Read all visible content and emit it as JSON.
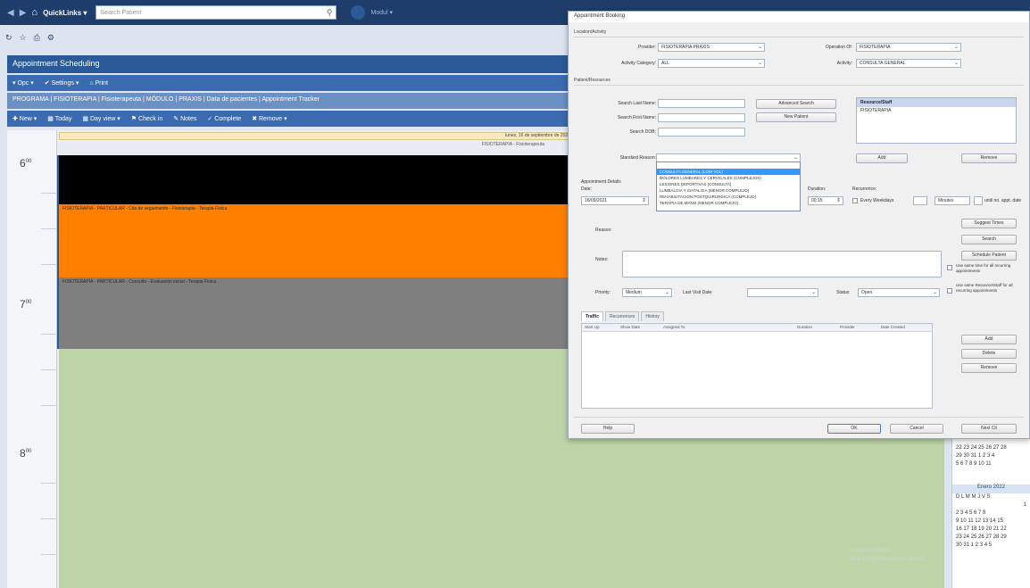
{
  "topbar": {
    "quicklinks_label": "QuickLinks ▾",
    "search_placeholder": "Search Patient",
    "menu_label": "Modul ▾"
  },
  "module": {
    "title": "Appointment Scheduling",
    "toolbar1": [
      "▾ Opc ▾",
      "✔ Settings ▾",
      "⌂ Print"
    ],
    "toolbar2": "PROGRAMA  | FISIOTERAPIA | Fisioterapeuta | MÓDULO | PRAXIS | Data de pacientes | Appointment Tracker",
    "toolbar3": [
      "✚ New ▾",
      "▦ Today",
      "▦ Day view ▾",
      "⚑ Check in",
      "✎ Notes",
      "✓ Complete",
      "✖ Remove ▾"
    ]
  },
  "calendar": {
    "day_header": "lunes, 16 de septiembre de 2021",
    "day_subheader": "FISIOTERAPIA - Fisioterapeuta",
    "hours": [
      "6",
      "7",
      "8"
    ],
    "appt_orange": "FISIOTERAPIA - PARTICULAR  -  Cita de seguimiento  -  Fisioterapia  -  Terapia Física",
    "appt_gray": "FISIOTERAPIA - PARTICULAR  -  Consulta  -  Evaluación inicial  -  Terapia Física"
  },
  "minical": {
    "month1_rows": [
      "22 23 24 25 26 27 28",
      "29 30 31 1 2 3 4",
      "5 6 7 8 9 10 11"
    ],
    "month2_head": "Enero 2022",
    "month2_rows": [
      "D L M M J V S",
      "1",
      "2 3 4 5 6 7 8",
      "9 10 11 12 13 14 15",
      "16 17 18 19 20 21 22",
      "23 24 25 26 27 28 29",
      "30 31 1 2 3 4 5"
    ]
  },
  "watermark": [
    "Activar Windows",
    "Ve a Configuración para activar"
  ],
  "dialog": {
    "title": "Appointment Booking",
    "sec_location": "Location/Activity",
    "lbl_provider": "Provider:",
    "val_provider": "FISIOTERAPIA PRAXIS",
    "lbl_operation": "Operation Of:",
    "val_operation": "FISIOTERAPIA",
    "lbl_activity_cat": "Activity Category:",
    "val_activity_cat": "ALL",
    "lbl_activity": "Activity:",
    "val_activity": "CONSULTA GENERAL",
    "sec_patient": "Patient/Resources",
    "lbl_last_name": "Search Last Name:",
    "lbl_first_name": "Search First Name:",
    "lbl_dob": "Search DOB:",
    "btn_advanced": "Advanced Search",
    "btn_new_patient": "New Patient",
    "res_head": "Resource/Staff",
    "res_row": "FISIOTERAPIA",
    "lbl_standard": "Standard Reason:",
    "btn_add": "Add",
    "btn_remove": "Remove",
    "dropdown_opts": [
      "CONSULTA GENERAL (LOW VOL)",
      "DOLORES LUMBARES Y CERVICALES (COMPLEJOS)",
      "LESIONES DEPORTIVAS (CONSULTA)",
      "LUMBALGIA Y SIATALGIA (MENOR COMPLEJO)",
      "REHABILITACION POSTQUIRURGICA (COMPLEJO)",
      "TERAPIA DE MANO (MENOR COMPLEJO)"
    ],
    "lbl_appt_details": "Appointment Details",
    "lbl_date": "Date:",
    "val_date": "16/09/2021",
    "lbl_duration": "Duration:",
    "val_duration": "00:15",
    "lbl_recurrence": "Recurrence:",
    "chk_every": "Every Weekdays",
    "lbl_minutes": "Minutes",
    "lbl_until": "until no. appt. date",
    "lbl_reason": "Reason:",
    "lbl_notes": "Notes:",
    "btn_suggest": "Suggest Times",
    "btn_search": "Search",
    "btn_schedule": "Schedule Patient",
    "chk_sms": "Use same time for all recurring appointments",
    "chk_send": "Use same Resource/Staff for all recurring appointments",
    "lbl_priority": "Priority:",
    "val_priority": "Medium",
    "lbl_last_visit": "Last Visit Date:",
    "lbl_status": "Status:",
    "val_status": "Open",
    "tab_traffic": "Traffic",
    "tab_recurrences": "Recurrences",
    "tab_history": "History",
    "grid_cols": [
      "Start Up",
      "Show Date",
      "Assigned To",
      "Duration",
      "Provider",
      "Date Created"
    ],
    "btn_add2": "Add",
    "btn_delete": "Delete",
    "btn_remove2": "Remove",
    "btn_help": "Help",
    "btn_ok": "OK",
    "btn_cancel": "Cancel",
    "btn_next": "Next Cit"
  },
  "colors": {
    "navy": "#1e3d6b",
    "orange": "#ff8000",
    "gray": "#7f7f7f",
    "green": "#bdd4a9",
    "black": "#000000"
  }
}
